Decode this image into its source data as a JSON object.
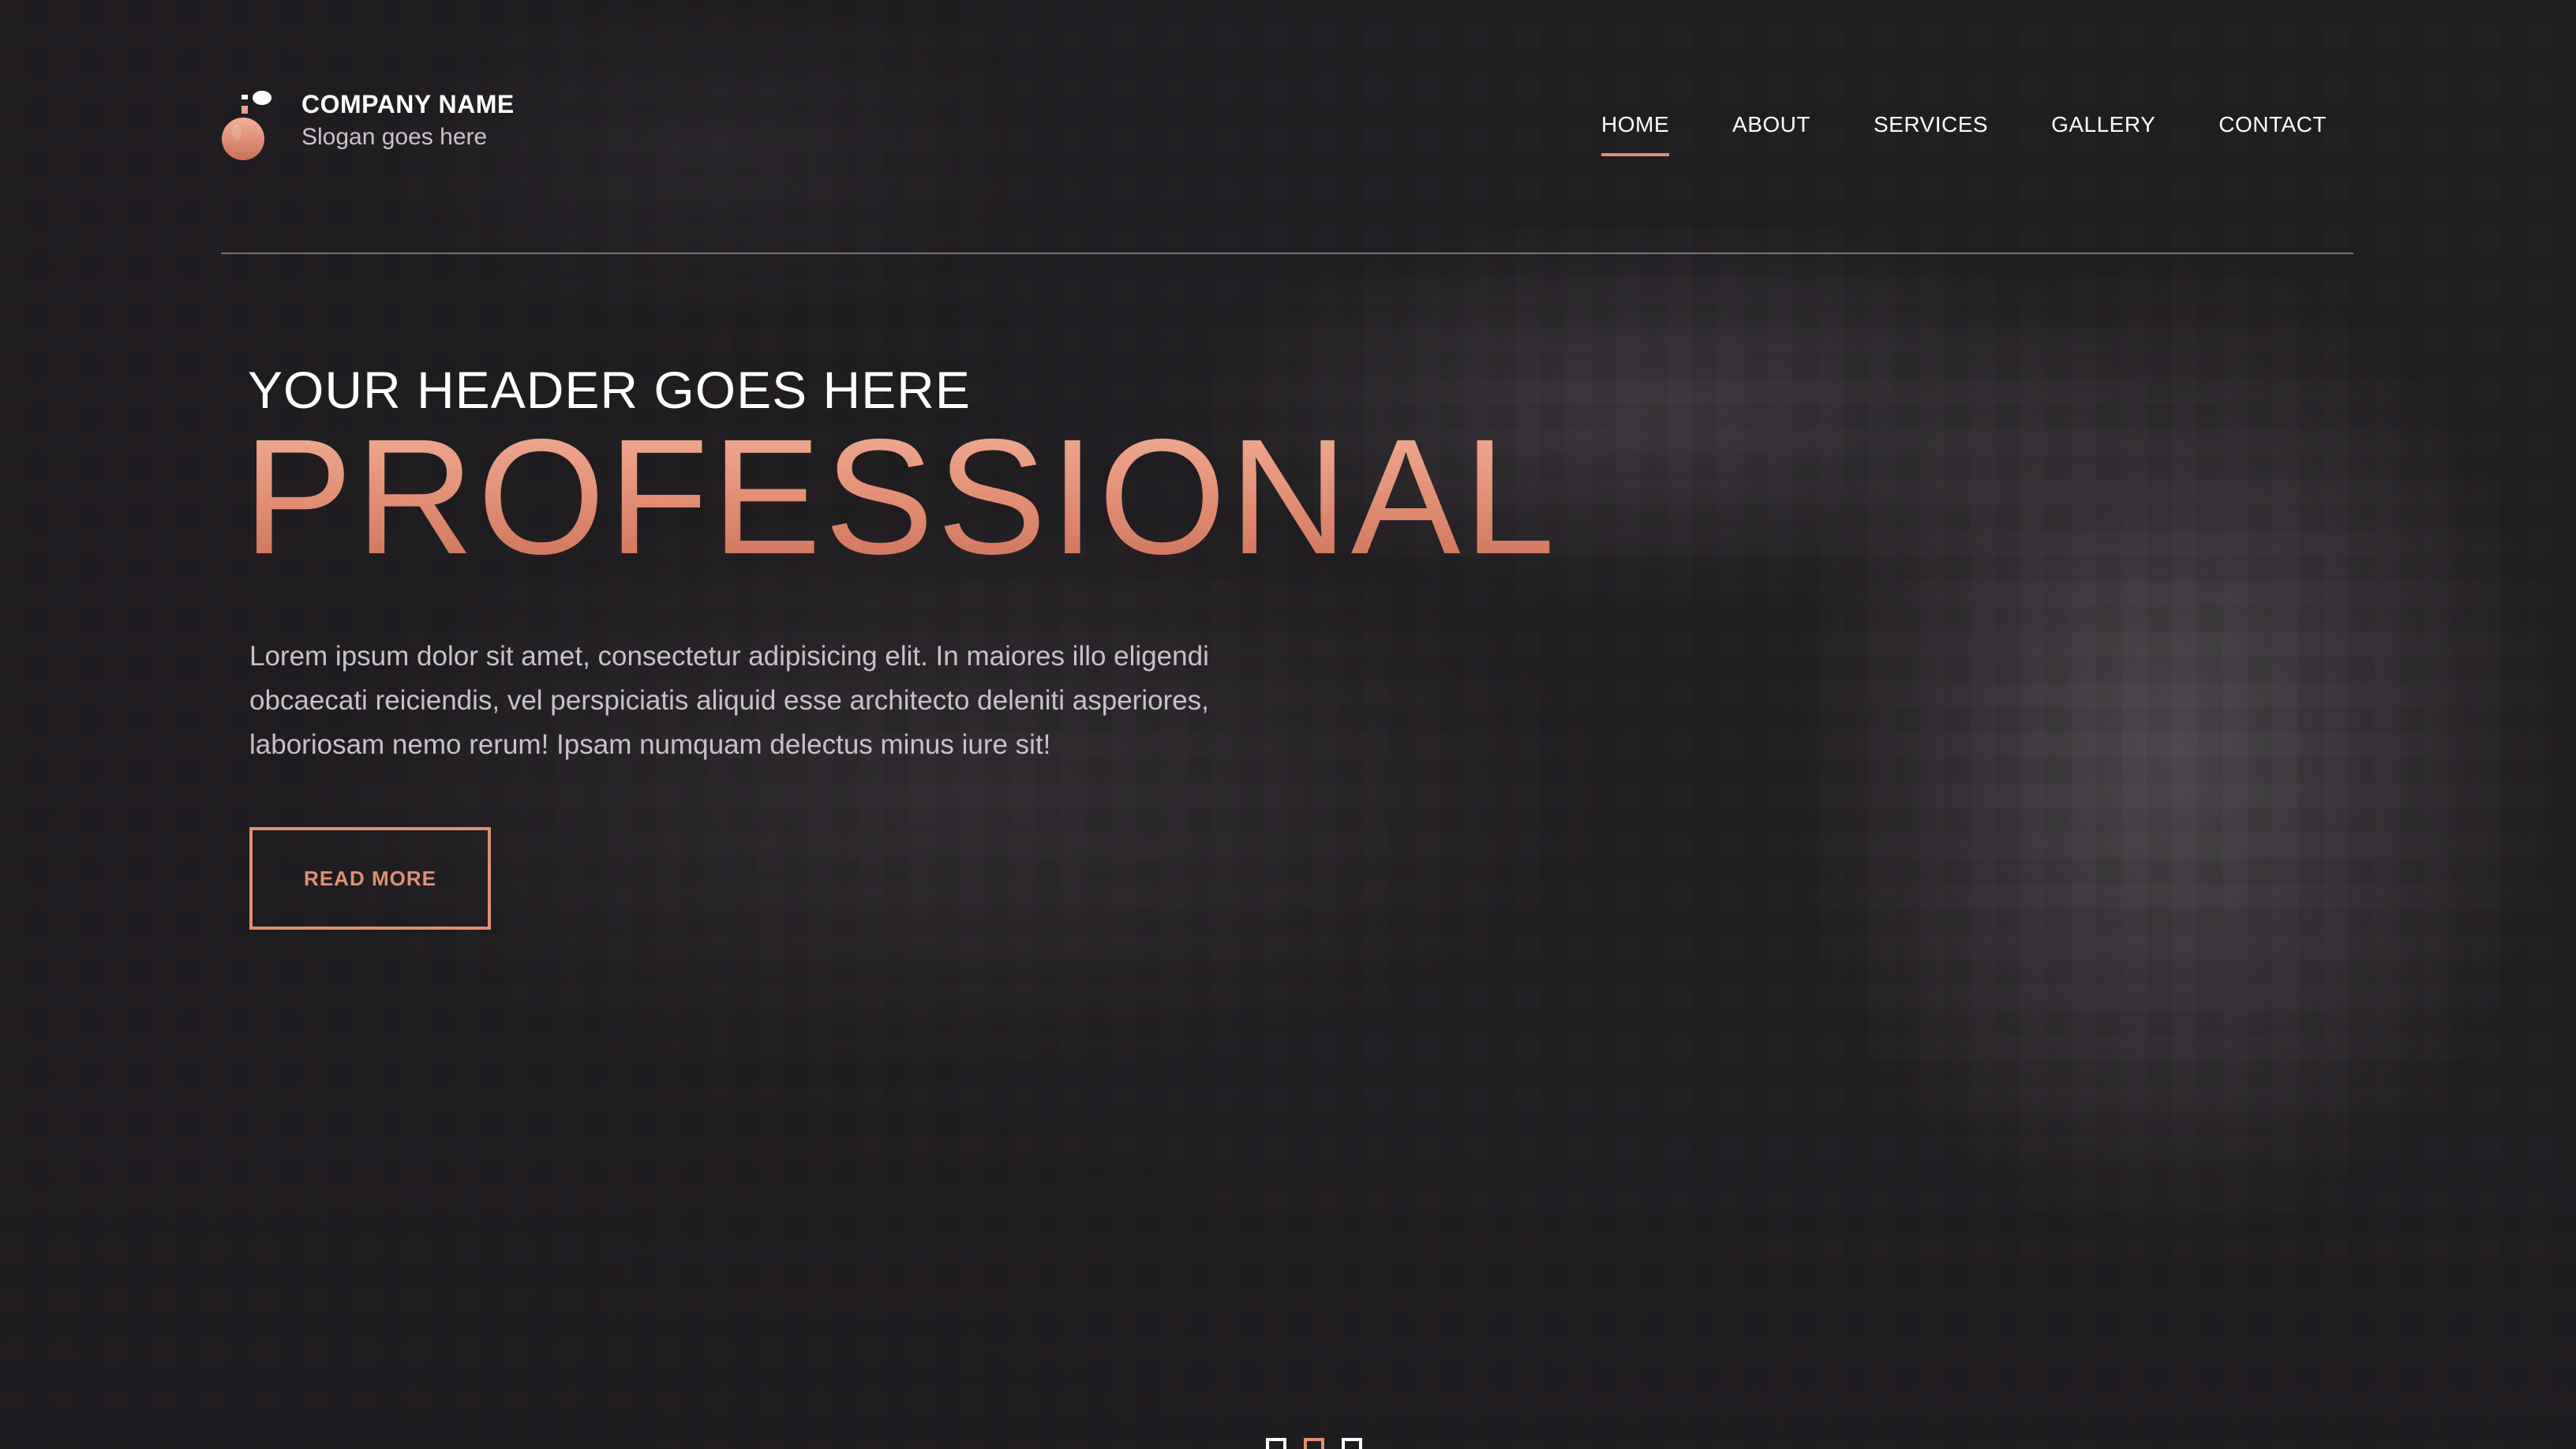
{
  "header": {
    "company_name": "COMPANY NAME",
    "slogan": "Slogan goes here",
    "logo_icon": "perfume-bottle-icon"
  },
  "nav": {
    "items": [
      {
        "label": "HOME",
        "active": true
      },
      {
        "label": "ABOUT",
        "active": false
      },
      {
        "label": "SERVICES",
        "active": false
      },
      {
        "label": "GALLERY",
        "active": false
      },
      {
        "label": "CONTACT",
        "active": false
      }
    ]
  },
  "hero": {
    "kicker": "YOUR HEADER GOES HERE",
    "title": "PROFESSIONAL",
    "body": "Lorem ipsum dolor sit amet, consectetur adipisicing elit. In maiores illo eligendi obcaecati reiciendis, vel perspiciatis aliquid esse architecto deleniti asperiores, laboriosam nemo rerum! Ipsam numquam delectus minus iure sit!",
    "cta_label": "READ MORE"
  },
  "slider": {
    "count": 3,
    "active_index": 1
  },
  "colors": {
    "accent": "#e08f73",
    "background": "#211e22",
    "text": "#ffffff",
    "muted_text": "#c7c2c8"
  }
}
